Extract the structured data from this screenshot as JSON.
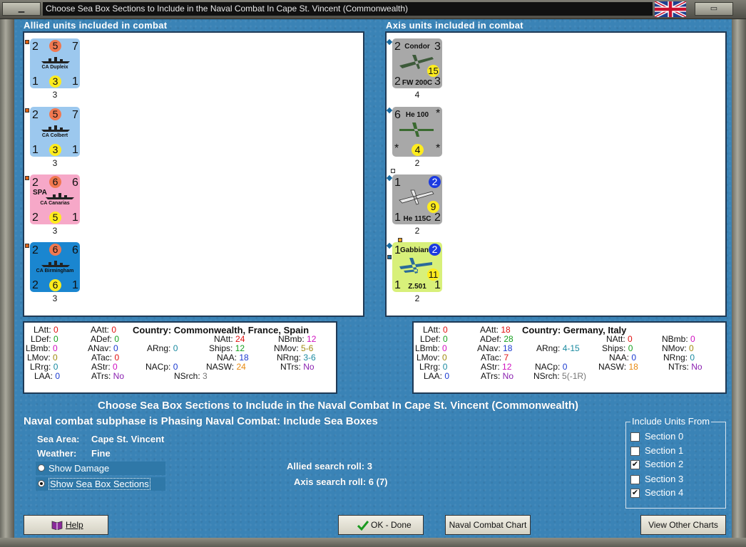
{
  "window": {
    "title": "Choose Sea Box Sections to Include in the Naval Combat In Cape St. Vincent (Commonwealth)"
  },
  "allied": {
    "label": "Allied units included in combat",
    "units": [
      {
        "name": "CA Dupleix",
        "tl": "2",
        "tc": "5",
        "tr": "7",
        "bl": "1",
        "bc": "3",
        "br": "1",
        "below": "3",
        "color": "#9cc8ee"
      },
      {
        "name": "CA Colbert",
        "tl": "2",
        "tc": "5",
        "tr": "7",
        "bl": "1",
        "bc": "3",
        "br": "1",
        "below": "3",
        "color": "#9cc8ee"
      },
      {
        "name": "CA Canarias",
        "tag": "SPA",
        "tl": "2",
        "tc": "6",
        "tr": "6",
        "bl": "2",
        "bc": "5",
        "br": "1",
        "below": "3",
        "color": "#f6a8c8"
      },
      {
        "name": "CA Birmingham",
        "tl": "2",
        "tc": "6",
        "tr": "6",
        "bl": "2",
        "bc": "6",
        "br": "1",
        "below": "3",
        "color": "#1a86d0"
      }
    ]
  },
  "axis": {
    "label": "Axis units included in combat",
    "units": [
      {
        "top": "Condor",
        "model": "FW 200C",
        "tl": "2",
        "tr": "3",
        "bl": "2",
        "br": "3",
        "circle": "15",
        "below": "4",
        "color": "#a8a8a8"
      },
      {
        "top": "He 100",
        "model": "",
        "tl": "6",
        "tr": "*",
        "bl": "*",
        "br": "*",
        "circle": "4",
        "below": "2",
        "color": "#a8a8a8"
      },
      {
        "top": "",
        "model": "He 115C",
        "tl": "1",
        "tr": "2",
        "bl": "1",
        "br": "2",
        "circle": "9",
        "below": "2",
        "color": "#a8a8a8"
      },
      {
        "top": "Gabbiano",
        "model": "Z.501",
        "tl": "1",
        "tr": "2",
        "bl": "1",
        "br": "1",
        "circle": "11",
        "below": "2",
        "color": "#d8f07a"
      }
    ]
  },
  "allied_stats": {
    "country": "Country: Commonwealth, France, Spain",
    "LAtt": "0",
    "LDef": "0",
    "LBmb": "0",
    "LMov": "0",
    "LRrg": "0",
    "LAA": "0",
    "AAtt": "0",
    "ADef": "0",
    "ANav": "0",
    "ATac": "0",
    "AStr": "0",
    "ATrs": "No",
    "ARng": "0",
    "NACp": "0",
    "NAtt": "24",
    "Ships": "12",
    "NAA": "18",
    "NASW": "24",
    "NBmb": "12",
    "NMov": "5-6",
    "NRng": "3-6",
    "NTrs": "No",
    "NSrch": "3"
  },
  "axis_stats": {
    "country": "Country: Germany, Italy",
    "LAtt": "0",
    "LDef": "0",
    "LBmb": "0",
    "LMov": "0",
    "LRrg": "0",
    "LAA": "0",
    "AAtt": "18",
    "ADef": "28",
    "ANav": "18",
    "ATac": "7",
    "AStr": "12",
    "ATrs": "No",
    "ARng": "4-15",
    "NACp": "0",
    "NAtt": "0",
    "Ships": "0",
    "NAA": "0",
    "NASW": "18",
    "NBmb": "0",
    "NMov": "0",
    "NRng": "0",
    "NTrs": "No",
    "NSrch": "5(-1R)"
  },
  "labels": {
    "LAtt": "LAtt:",
    "LDef": "LDef:",
    "LBmb": "LBmb:",
    "LMov": "LMov:",
    "LRrg": "LRrg:",
    "LAA": "LAA:",
    "AAtt": "AAtt:",
    "ADef": "ADef:",
    "ANav": "ANav:",
    "ATac": "ATac:",
    "AStr": "AStr:",
    "ATrs": "ATrs:",
    "ARng": "ARng:",
    "NACp": "NACp:",
    "NAtt": "NAtt:",
    "Ships": "Ships:",
    "NAA": "NAA:",
    "NASW": "NASW:",
    "NBmb": "NBmb:",
    "NMov": "NMov:",
    "NRng": "NRng:",
    "NTrs": "NTrs:",
    "NSrch": "NSrch:"
  },
  "main": {
    "heading": "Choose Sea Box Sections to Include in the Naval Combat In Cape St. Vincent (Commonwealth)",
    "subphase": "Naval combat subphase is Phasing Naval Combat: Include Sea Boxes",
    "sea_area_label": "Sea Area:",
    "sea_area_value": "Cape St. Vincent",
    "weather_label": "Weather:",
    "weather_value": "Fine",
    "allied_search": "Allied search roll: 3",
    "axis_search": "Axis search roll: 6 (7)"
  },
  "options": {
    "show_damage": "Show Damage",
    "show_sections": "Show Sea Box Sections"
  },
  "include": {
    "legend": "Include Units From",
    "sections": [
      {
        "label": "Section 0",
        "checked": false
      },
      {
        "label": "Section 1",
        "checked": false
      },
      {
        "label": "Section 2",
        "checked": true
      },
      {
        "label": "Section 3",
        "checked": false
      },
      {
        "label": "Section 4",
        "checked": true
      }
    ]
  },
  "buttons": {
    "help": "Help",
    "ok": "OK - Done",
    "naval_chart": "Naval Combat Chart",
    "other_charts": "View Other Charts"
  }
}
